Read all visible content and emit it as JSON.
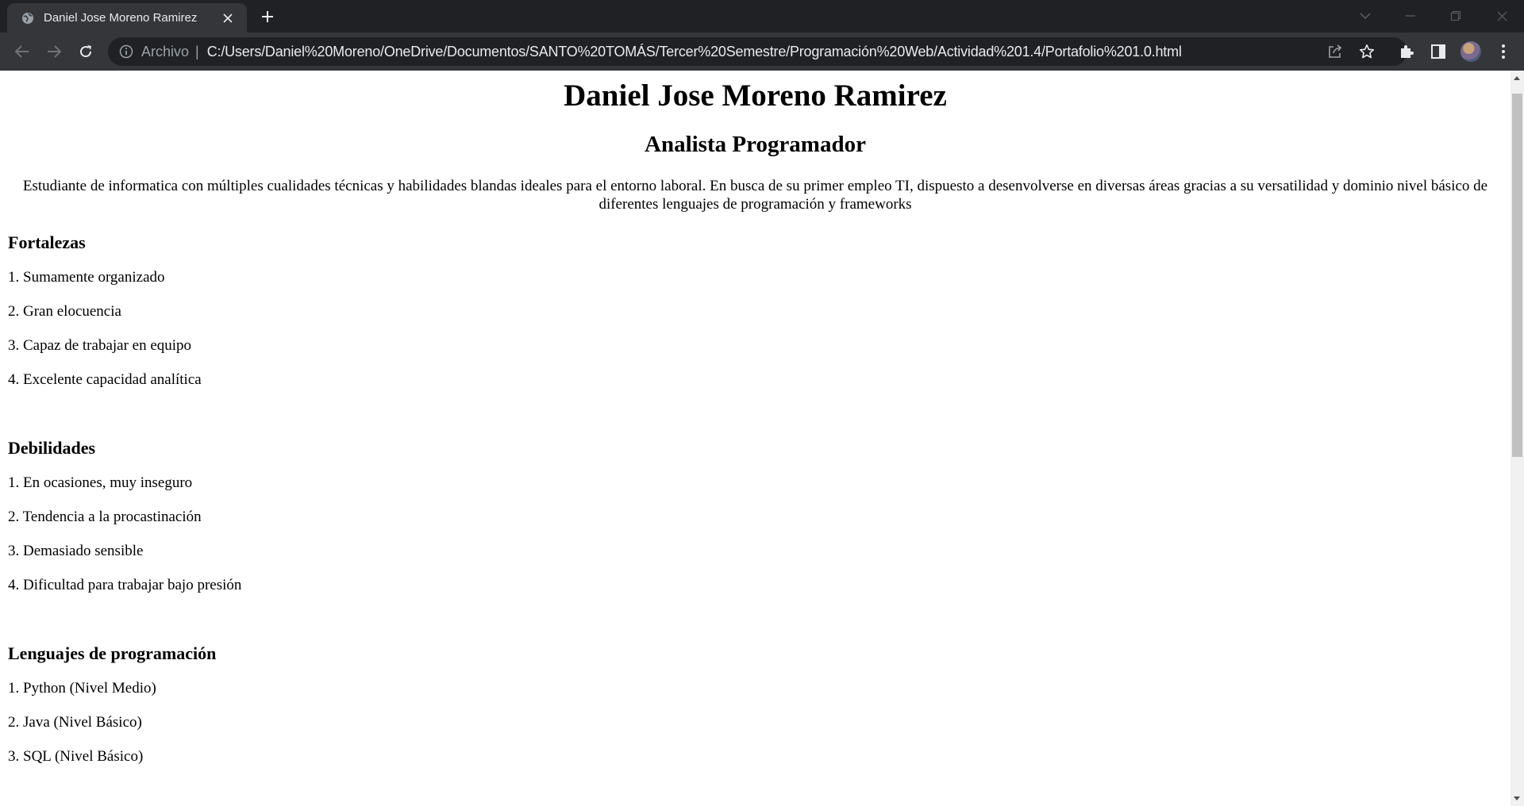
{
  "browser": {
    "tab_title": "Daniel Jose Moreno Ramirez",
    "scheme_label": "Archivo",
    "separator": "|",
    "url": "C:/Users/Daniel%20Moreno/OneDrive/Documentos/SANTO%20TOMÁS/Tercer%20Semestre/Programación%20Web/Actividad%201.4/Portafolio%201.0.html"
  },
  "page": {
    "name": "Daniel Jose Moreno Ramirez",
    "role": "Analista Programador",
    "summary": "Estudiante de informatica con múltiples cualidades técnicas y habilidades blandas ideales para el entorno laboral. En busca de su primer empleo TI, dispuesto a desenvolverse en diversas áreas gracias a su versatilidad y dominio nivel básico de diferentes lenguajes de programación y frameworks",
    "sections": [
      {
        "title": "Fortalezas",
        "items": [
          "1. Sumamente organizado",
          "2. Gran elocuencia",
          "3. Capaz de trabajar en equipo",
          "4. Excelente capacidad analítica"
        ]
      },
      {
        "title": "Debilidades",
        "items": [
          "1. En ocasiones, muy inseguro",
          "2. Tendencia a la procastinación",
          "3. Demasiado sensible",
          "4. Dificultad para trabajar bajo presión"
        ]
      },
      {
        "title": "Lenguajes de programación",
        "items": [
          "1. Python (Nivel Medio)",
          "2. Java (Nivel Básico)",
          "3. SQL (Nivel Básico)"
        ]
      }
    ]
  }
}
